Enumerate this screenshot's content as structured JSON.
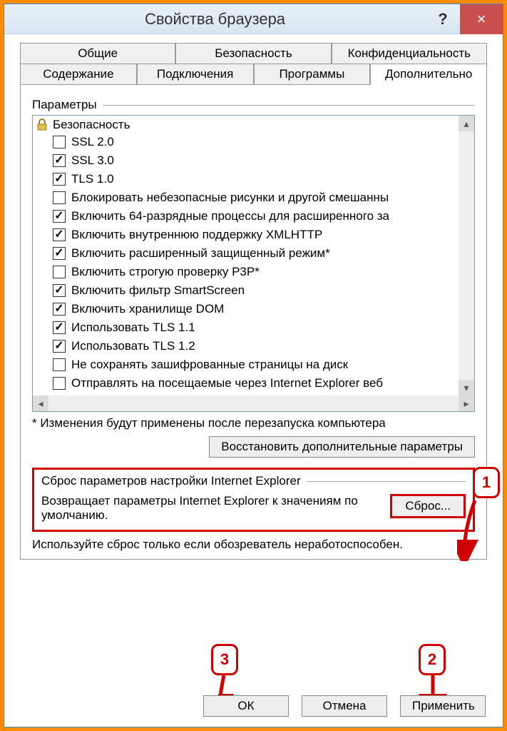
{
  "window": {
    "title": "Свойства браузера",
    "help": "?",
    "close": "×"
  },
  "tabs": {
    "row1": [
      "Общие",
      "Безопасность",
      "Конфиденциальность"
    ],
    "row2": [
      "Содержание",
      "Подключения",
      "Программы",
      "Дополнительно"
    ],
    "active": "Дополнительно"
  },
  "group": {
    "label": "Параметры",
    "category": "Безопасность",
    "items": [
      {
        "checked": false,
        "label": "SSL 2.0"
      },
      {
        "checked": true,
        "label": "SSL 3.0"
      },
      {
        "checked": true,
        "label": "TLS 1.0"
      },
      {
        "checked": false,
        "label": "Блокировать небезопасные рисунки и другой смешанны"
      },
      {
        "checked": true,
        "label": "Включить 64-разрядные процессы для расширенного за"
      },
      {
        "checked": true,
        "label": "Включить внутреннюю поддержку XMLHTTP"
      },
      {
        "checked": true,
        "label": "Включить расширенный защищенный режим*"
      },
      {
        "checked": false,
        "label": "Включить строгую проверку P3P*"
      },
      {
        "checked": true,
        "label": "Включить фильтр SmartScreen"
      },
      {
        "checked": true,
        "label": "Включить хранилище DOM"
      },
      {
        "checked": true,
        "label": "Использовать TLS 1.1"
      },
      {
        "checked": true,
        "label": "Использовать TLS 1.2"
      },
      {
        "checked": false,
        "label": "Не сохранять зашифрованные страницы на диск"
      },
      {
        "checked": false,
        "label": "Отправлять на посещаемые через Internet Explorer веб"
      }
    ],
    "footnote": "* Изменения будут применены после перезапуска компьютера",
    "restore_button": "Восстановить дополнительные параметры"
  },
  "reset": {
    "label": "Сброс параметров настройки Internet Explorer",
    "desc": "Возвращает параметры Internet Explorer к значениям по умолчанию.",
    "button": "Сброс...",
    "warn": "Используйте сброс только если обозреватель неработоспособен."
  },
  "buttons": {
    "ok": "ОК",
    "cancel": "Отмена",
    "apply": "Применить"
  },
  "annotations": {
    "n1": "1",
    "n2": "2",
    "n3": "3"
  }
}
